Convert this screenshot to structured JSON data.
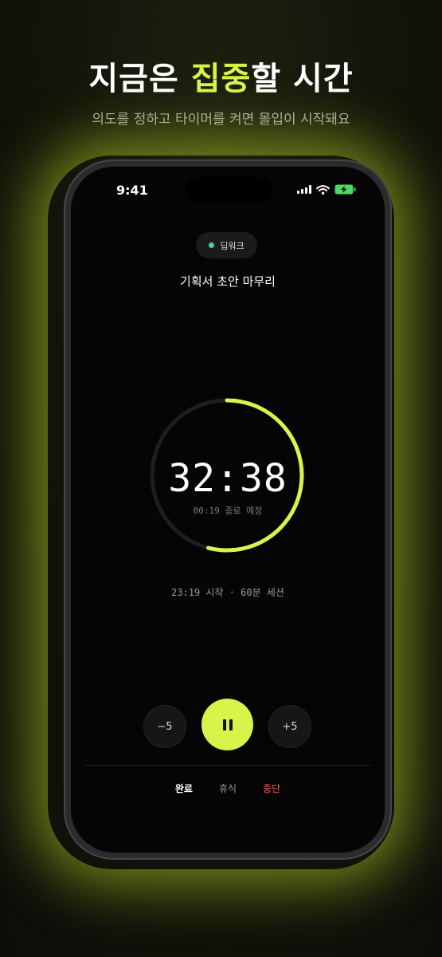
{
  "headline": {
    "part1": "지금은 ",
    "accent": "집중",
    "part2": "할 시간"
  },
  "subline": "의도를 정하고 타이머를 켜면 몰입이 시작돼요",
  "status_bar": {
    "time": "9:41",
    "icons": [
      "signal-icon",
      "wifi-icon",
      "battery-charging-icon"
    ]
  },
  "session": {
    "category_tag": "딥워크",
    "task_title": "기획서 초안 마무리",
    "remaining": "32:38",
    "end_note": "00:19 종료 예정",
    "info": "23:19 시작 · 60분 세션",
    "progress_remaining_fraction": 0.54
  },
  "controls": {
    "minus_label": "−5",
    "plus_label": "+5",
    "pause_icon": "pause-icon"
  },
  "actions": {
    "done": "완료",
    "rest": "휴식",
    "stop": "중단"
  },
  "colors": {
    "accent": "#d8f34a",
    "tag_dot": "#43d3a8",
    "stop": "#ff5a5a",
    "battery": "#4cd964"
  }
}
